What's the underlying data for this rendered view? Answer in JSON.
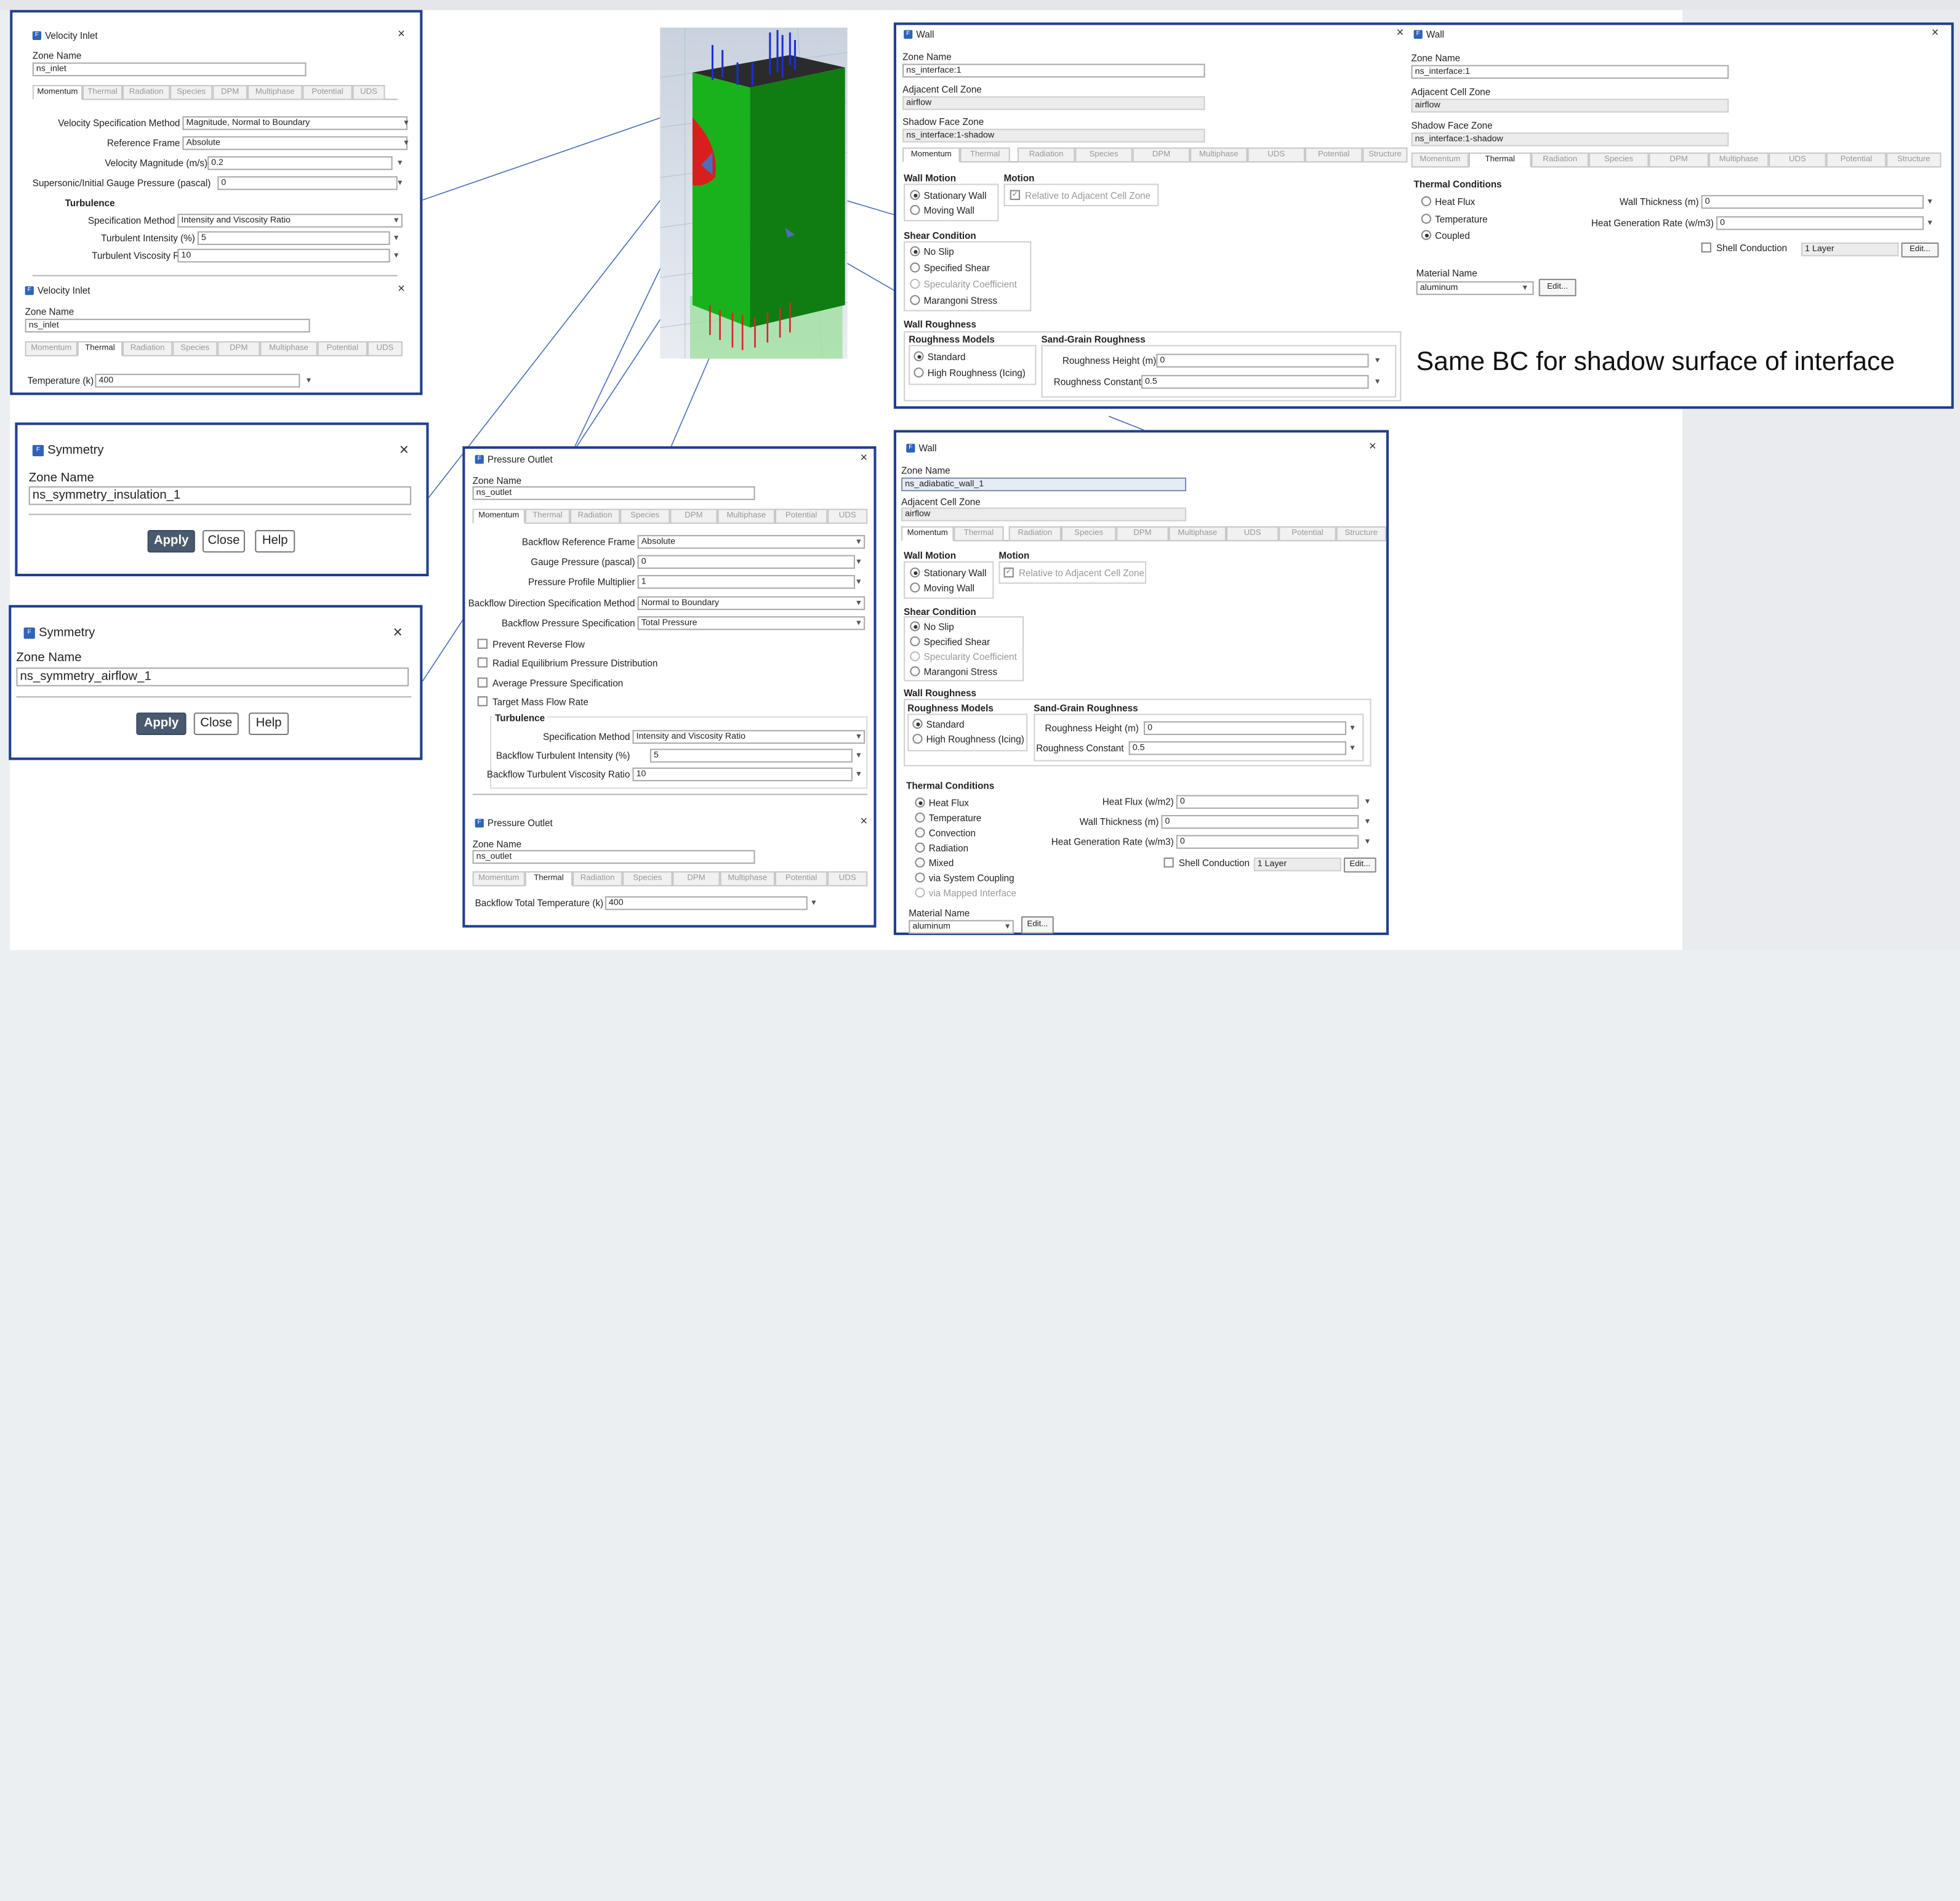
{
  "annotation": "Same BC for shadow surface of interface",
  "common": {
    "close_icon": "×",
    "zone_name_label": "Zone Name",
    "adjacent_cell_zone_label": "Adjacent Cell Zone",
    "shadow_face_zone_label": "Shadow Face Zone",
    "apply": "Apply",
    "close": "Close",
    "help": "Help",
    "edit": "Edit..."
  },
  "tabs7": [
    "Momentum",
    "Thermal",
    "Radiation",
    "Species",
    "DPM",
    "Multiphase",
    "Potential",
    "UDS"
  ],
  "tabs9": [
    "Momentum",
    "Thermal",
    "Radiation",
    "Species",
    "DPM",
    "Multiphase",
    "UDS",
    "Potential",
    "Structure"
  ],
  "velocity_inlet_momentum": {
    "title": "Velocity Inlet",
    "zone_name": "ns_inlet",
    "rows": [
      {
        "label": "Velocity Specification Method",
        "value": "Magnitude, Normal to Boundary"
      },
      {
        "label": "Reference Frame",
        "value": "Absolute"
      },
      {
        "label": "Velocity Magnitude (m/s)",
        "value": "0.2"
      },
      {
        "label": "Supersonic/Initial Gauge Pressure (pascal)",
        "value": "0"
      }
    ],
    "turbulence_label": "Turbulence",
    "turb_rows": [
      {
        "label": "Specification Method",
        "value": "Intensity and Viscosity Ratio"
      },
      {
        "label": "Turbulent Intensity (%)",
        "value": "5"
      },
      {
        "label": "Turbulent Viscosity Ratio",
        "value": "10"
      }
    ]
  },
  "velocity_inlet_thermal": {
    "title": "Velocity Inlet",
    "zone_name": "ns_inlet",
    "temperature_label": "Temperature (k)",
    "temperature": "400"
  },
  "symmetry_insulation": {
    "title": "Symmetry",
    "zone_name": "ns_symmetry_insulation_1"
  },
  "symmetry_airflow": {
    "title": "Symmetry",
    "zone_name": "ns_symmetry_airflow_1"
  },
  "pressure_outlet_momentum": {
    "title": "Pressure Outlet",
    "zone_name": "ns_outlet",
    "rows": [
      {
        "label": "Backflow Reference Frame",
        "value": "Absolute"
      },
      {
        "label": "Gauge Pressure (pascal)",
        "value": "0"
      },
      {
        "label": "Pressure Profile Multiplier",
        "value": "1"
      },
      {
        "label": "Backflow Direction Specification Method",
        "value": "Normal to Boundary"
      },
      {
        "label": "Backflow Pressure Specification",
        "value": "Total Pressure"
      }
    ],
    "checks": [
      "Prevent Reverse Flow",
      "Radial Equilibrium Pressure Distribution",
      "Average Pressure Specification",
      "Target Mass Flow Rate"
    ],
    "turbulence_label": "Turbulence",
    "turb_rows": [
      {
        "label": "Specification Method",
        "value": "Intensity and Viscosity Ratio"
      },
      {
        "label": "Backflow Turbulent Intensity (%)",
        "value": "5"
      },
      {
        "label": "Backflow Turbulent Viscosity Ratio",
        "value": "10"
      }
    ]
  },
  "pressure_outlet_thermal": {
    "title": "Pressure Outlet",
    "zone_name": "ns_outlet",
    "temp_label": "Backflow Total Temperature (k)",
    "temp": "400"
  },
  "wall_interface": {
    "title": "Wall",
    "zone_name": "ns_interface:1",
    "adjacent_cell_zone": "airflow",
    "shadow_face_zone": "ns_interface:1-shadow",
    "wall_motion_label": "Wall Motion",
    "motion_label": "Motion",
    "stationary": "Stationary Wall",
    "moving": "Moving Wall",
    "relative": "Relative to Adjacent Cell Zone",
    "shear_label": "Shear Condition",
    "shear": [
      "No Slip",
      "Specified Shear",
      "Specularity Coefficient",
      "Marangoni Stress"
    ],
    "roughness_label": "Wall Roughness",
    "roughness_models_label": "Roughness Models",
    "standard": "Standard",
    "high_roughness": "High Roughness (Icing)",
    "sand_grain_label": "Sand-Grain Roughness",
    "roughness_height_label": "Roughness Height (m)",
    "roughness_height": "0",
    "roughness_constant_label": "Roughness Constant",
    "roughness_constant": "0.5"
  },
  "wall_interface_thermal": {
    "title": "Wall",
    "zone_name": "ns_interface:1",
    "adjacent_cell_zone": "airflow",
    "shadow_face_zone": "ns_interface:1-shadow",
    "thermal_conditions_label": "Thermal Conditions",
    "options": [
      "Heat Flux",
      "Temperature",
      "Coupled"
    ],
    "wall_thickness_label": "Wall Thickness (m)",
    "wall_thickness": "0",
    "heat_gen_label": "Heat Generation Rate (w/m3)",
    "heat_gen": "0",
    "shell_conduction": "Shell Conduction",
    "layer": "1 Layer",
    "material_label": "Material Name",
    "material": "aluminum"
  },
  "wall_adiabatic": {
    "title": "Wall",
    "zone_name": "ns_adiabatic_wall_1",
    "adjacent_cell_zone": "airflow",
    "thermal_conditions_label": "Thermal Conditions",
    "thermal_options": [
      "Heat Flux",
      "Temperature",
      "Convection",
      "Radiation",
      "Mixed",
      "via System Coupling",
      "via Mapped Interface"
    ],
    "heat_flux_label": "Heat Flux (w/m2)",
    "heat_flux": "0",
    "wall_thickness_label": "Wall Thickness (m)",
    "wall_thickness": "0",
    "heat_gen_label": "Heat Generation Rate (w/m3)",
    "heat_gen": "0",
    "shell_conduction": "Shell Conduction",
    "layer": "1 Layer",
    "material_label": "Material Name",
    "material": "aluminum"
  },
  "colors": {
    "frame": "#1f3f8f",
    "primary_button": "#4a5a6e",
    "inlet_arrows": "#1a2fd6",
    "outlet_arrows": "#d6262a",
    "domain_green": "#19b21c"
  }
}
